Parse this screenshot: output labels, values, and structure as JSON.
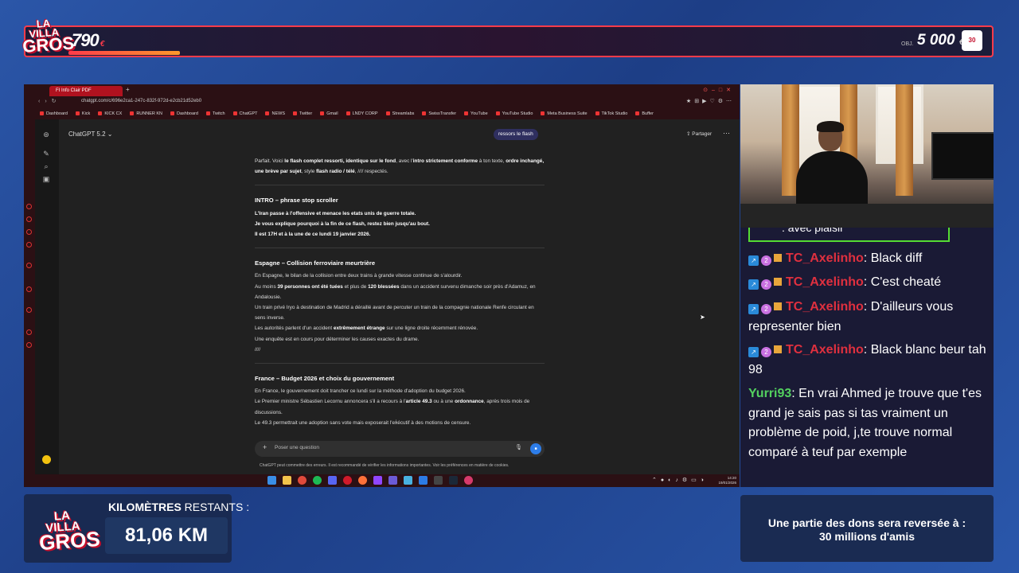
{
  "overlay": {
    "logo_line1": "LA VILLA",
    "logo_line2": "GROS",
    "sub_count": "790",
    "sub_unit": "€",
    "goal_label": "OBJ.",
    "goal_value": "5 000",
    "goal_unit": "€",
    "km_title": "KILOMÈTRES",
    "km_title_rest": " RESTANTS :",
    "km_value": "81,06 KM",
    "donation_line1": "Une partie des dons sera reversée à :",
    "donation_line2": "30 millions d'amis"
  },
  "browser": {
    "tab_label": "FI Info Clair PDF",
    "url": "chatgpt.com/c/696e2ca1-247c-832f-972d-e2cb21d52eb0",
    "bookmarks": [
      "Dashboard",
      "Kick",
      "KICK CX",
      "RUNNER KN",
      "Dashboard",
      "Twitch",
      "ChatGPT",
      "NEWS",
      "Twitter",
      "Gmail",
      "LNDY CORP",
      "Streamlabs",
      "SwissTransfer",
      "YouTube",
      "YouTube Studio",
      "Meta Business Suite",
      "TikTok Studio",
      "Buffer"
    ]
  },
  "chatgpt": {
    "model": "ChatGPT 5.2 ⌄",
    "user_chip": "ressors le flash",
    "share": "Partager",
    "intro_para_1": "Parfait. Voici ",
    "intro_para_b1": "le flash complet ressorti, identique sur le fond",
    "intro_para_2": ", avec l'",
    "intro_para_b2": "intro strictement conforme",
    "intro_para_3": " à ton texte, ",
    "intro_para_b3": "ordre inchangé, une brève par sujet",
    "intro_para_4": ", style ",
    "intro_para_b4": "flash radio / télé",
    "intro_para_5": ", //// respectés.",
    "s1_title": "INTRO – phrase stop scroller",
    "s1_l1": "L'Iran passe à l'offensive et menace les etats unis de guerre totale.",
    "s1_l2": "Je vous explique pourquoi à la fin de ce flash, restez bien jusqu'au bout.",
    "s1_l3": "Il est 17H et à la une de ce lundi 19 janvier 2026.",
    "s2_title": "Espagne – Collision ferroviaire meurtrière",
    "s2_l1": "En Espagne, le bilan de la collision entre deux trains à grande vitesse continue de s'alourdir.",
    "s2_l2a": "Au moins ",
    "s2_l2b": "39 personnes ont été tuées",
    "s2_l2c": " et plus de ",
    "s2_l2d": "120 blessées",
    "s2_l2e": " dans un accident survenu dimanche soir près d'Adamuz, en Andalousie.",
    "s2_l3": "Un train privé Iryo à destination de Madrid a déraillé avant de percuter un train de la compagnie nationale Renfe circulant en sens inverse.",
    "s2_l4a": "Les autorités parlent d'un accident ",
    "s2_l4b": "extrêmement étrange",
    "s2_l4c": " sur une ligne droite récemment rénovée.",
    "s2_l5": "Une enquête est en cours pour déterminer les causes exactes du drame.",
    "s2_l6": "////",
    "s3_title": "France – Budget 2026 et choix du gouvernement",
    "s3_l1": "En France, le gouvernement doit trancher ce lundi sur la méthode d'adoption du budget 2026.",
    "s3_l2a": "Le Premier ministre Sébastien Lecornu annoncera s'il a recours à l'",
    "s3_l2b": "article 49.3",
    "s3_l2c": " ou à une ",
    "s3_l2d": "ordonnance",
    "s3_l2e": ", après trois mois de discussions.",
    "s3_l3": "Le 49.3 permettrait une adoption sans vote mais exposerait l'exécutif à des motions de censure.",
    "composer_placeholder": "Poser une question",
    "disclaimer": "ChatGPT peut commettre des erreurs. Il est recommandé de vérifier les informations importantes. Voir les préférences en matière de cookies."
  },
  "taskbar": {
    "time": "14:20",
    "date": "19/01/2026"
  },
  "chat": {
    "partial_text": ": avec plaisir",
    "messages": [
      {
        "user": "TC_Axelinho",
        "text": "Black diff"
      },
      {
        "user": "TC_Axelinho",
        "text": "C'est cheaté"
      },
      {
        "user": "TC_Axelinho",
        "text": "D'ailleurs vous representer bien"
      },
      {
        "user": "TC_Axelinho",
        "text": "Black blanc beur tah 98"
      },
      {
        "user": "Yurri93",
        "text": "En vrai Ahmed je trouve que t'es grand je sais pas si tas vraiment un problème de poid, j,te trouve normal comparé à teuf par exemple"
      }
    ]
  },
  "colors": {
    "accent_red": "#ff3b4a",
    "chat_user_red": "#e0303f",
    "chat_user_green": "#53d15f",
    "overlay_blue": "#2b56a8"
  }
}
